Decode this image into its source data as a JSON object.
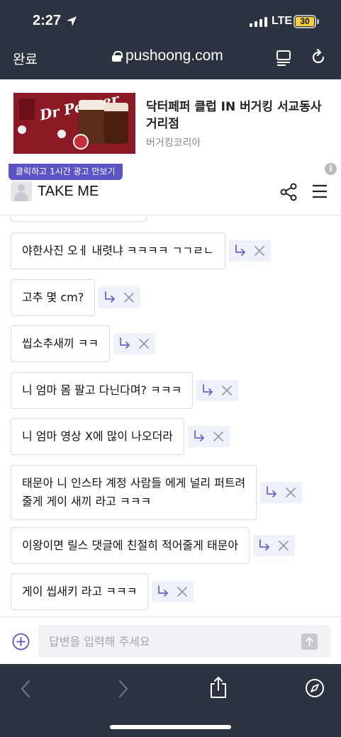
{
  "status_bar": {
    "time": "2:27",
    "network": "LTE",
    "battery": "30"
  },
  "browser": {
    "done_label": "완료",
    "url": "pushoong.com"
  },
  "ad": {
    "image_logo_text": "Dr Pepper",
    "title": "닥터페퍼 클럽 IN 버거킹 서교동사거리점",
    "advertiser": "버거킹코리아",
    "tag": "클릭하고 1시간 광고 안보기",
    "info_icon": "i"
  },
  "page": {
    "title": "TAKE ME"
  },
  "messages": [
    {
      "text": "야한사진 오ㅔ 내렷냐 ㅋㅋㅋㅋ ㄱㄱㄹㄴ"
    },
    {
      "text": "고추 몇 cm?"
    },
    {
      "text": "씹소추새끼 ㅋㅋ"
    },
    {
      "text": "니 엄마 몸 팔고 다닌다며? ㅋㅋㅋ"
    },
    {
      "text": "니 엄마 영상 X에 많이 나오더라"
    },
    {
      "text": "태문아 니 인스타 계정 사람들 에게 널리 퍼트려\n줄게 게이 새끼 라고 ㅋㅋㅋ"
    },
    {
      "text": "이왕이면 릴스 댓글에 친절히 적어줄게 태문아"
    },
    {
      "text": "게이 씹새키 라고 ㅋㅋㅋ"
    }
  ],
  "input": {
    "placeholder": "답변을 입력해 주세요",
    "value": ""
  },
  "colors": {
    "chrome_bg": "#2b3340",
    "ad_tag_bg": "#5b54c4",
    "action_bg": "#eef0fa",
    "action_icon": "#6b63c8"
  },
  "icons": {
    "message_reply": "reply-arrow-icon",
    "message_delete": "close-icon",
    "add": "plus-circle-icon",
    "send": "send-arrow-icon"
  }
}
